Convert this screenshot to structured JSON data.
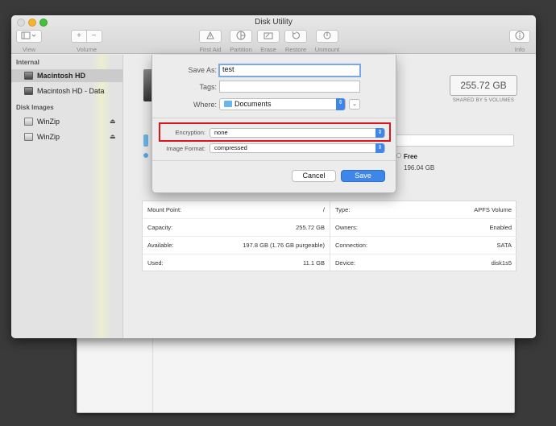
{
  "window": {
    "title": "Disk Utility"
  },
  "toolbar": {
    "view_label": "View",
    "volume_label": "Volume",
    "first_aid_label": "First Aid",
    "partition_label": "Partition",
    "erase_label": "Erase",
    "restore_label": "Restore",
    "unmount_label": "Unmount",
    "info_label": "Info",
    "volume_add_glyph": "+",
    "volume_remove_glyph": "−"
  },
  "sidebar": {
    "internal_header": "Internal",
    "items_internal": [
      {
        "label": "Macintosh HD",
        "selected": true
      },
      {
        "label": "Macintosh HD - Data",
        "selected": false
      }
    ],
    "disk_images_header": "Disk Images",
    "items_images": [
      {
        "label": "WinZip"
      },
      {
        "label": "WinZip"
      }
    ]
  },
  "content": {
    "size": "255.72 GB",
    "size_subtitle": "SHARED BY 5 VOLUMES",
    "free_label": "Free",
    "free_value": "196.04 GB",
    "info_left": [
      {
        "key": "Mount Point:",
        "value": "/"
      },
      {
        "key": "Capacity:",
        "value": "255.72 GB"
      },
      {
        "key": "Available:",
        "value": "197.8 GB (1.76 GB purgeable)"
      },
      {
        "key": "Used:",
        "value": "11.1 GB"
      }
    ],
    "info_right": [
      {
        "key": "Type:",
        "value": "APFS Volume"
      },
      {
        "key": "Owners:",
        "value": "Enabled"
      },
      {
        "key": "Connection:",
        "value": "SATA"
      },
      {
        "key": "Device:",
        "value": "disk1s5"
      }
    ]
  },
  "dialog": {
    "save_as_label": "Save As:",
    "save_as_value": "test",
    "tags_label": "Tags:",
    "tags_value": "",
    "where_label": "Where:",
    "where_value": "Documents",
    "encryption_label": "Encryption:",
    "encryption_value": "none",
    "format_label": "Image Format:",
    "format_value": "compressed",
    "cancel_label": "Cancel",
    "save_label": "Save"
  },
  "colors": {
    "accent": "#3f86e9",
    "highlight_box": "#e0141b",
    "folder": "#67b6ef"
  },
  "icons": [
    "view-icon",
    "first-aid-icon",
    "partition-icon",
    "erase-icon",
    "restore-icon",
    "unmount-icon",
    "info-icon",
    "disk-icon",
    "eject-icon",
    "folder-icon",
    "chevron-down-icon",
    "stepper-icon"
  ]
}
